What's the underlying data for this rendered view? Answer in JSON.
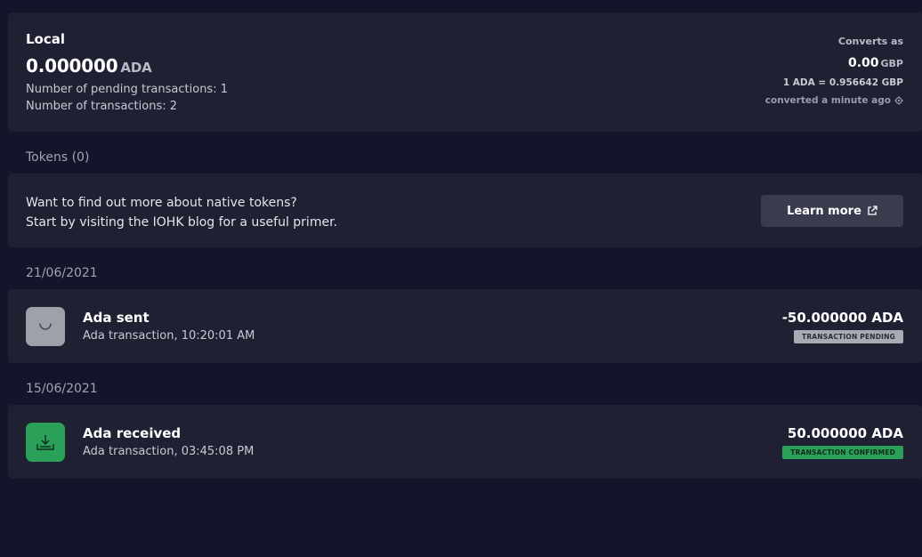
{
  "summary": {
    "wallet_name": "Local",
    "balance": "0.000000",
    "balance_unit": "ADA",
    "pending_label": "Number of pending transactions: 1",
    "tx_count_label": "Number of transactions: 2",
    "converts_as": "Converts as",
    "converted_value": "0.00",
    "converted_unit": "GBP",
    "rate": "1 ADA = 0.956642 GBP",
    "converted_time": "converted a minute ago"
  },
  "tokens": {
    "section_label": "Tokens (0)",
    "line1": "Want to find out more about native tokens?",
    "line2": "Start by visiting the IOHK blog for a useful primer.",
    "learn_more": "Learn more"
  },
  "transactions": [
    {
      "date": "21/06/2021",
      "title": "Ada sent",
      "subtitle": "Ada transaction, 10:20:01 AM",
      "amount": "-50.000000 ADA",
      "status": "TRANSACTION PENDING",
      "icon": "pending-spinner-icon"
    },
    {
      "date": "15/06/2021",
      "title": "Ada received",
      "subtitle": "Ada transaction, 03:45:08 PM",
      "amount": "50.000000 ADA",
      "status": "TRANSACTION CONFIRMED",
      "icon": "download-icon"
    }
  ],
  "colors": {
    "background": "#14152a",
    "card": "#1f2133",
    "confirmed": "#2aa058",
    "pending": "#9fa1aa"
  }
}
